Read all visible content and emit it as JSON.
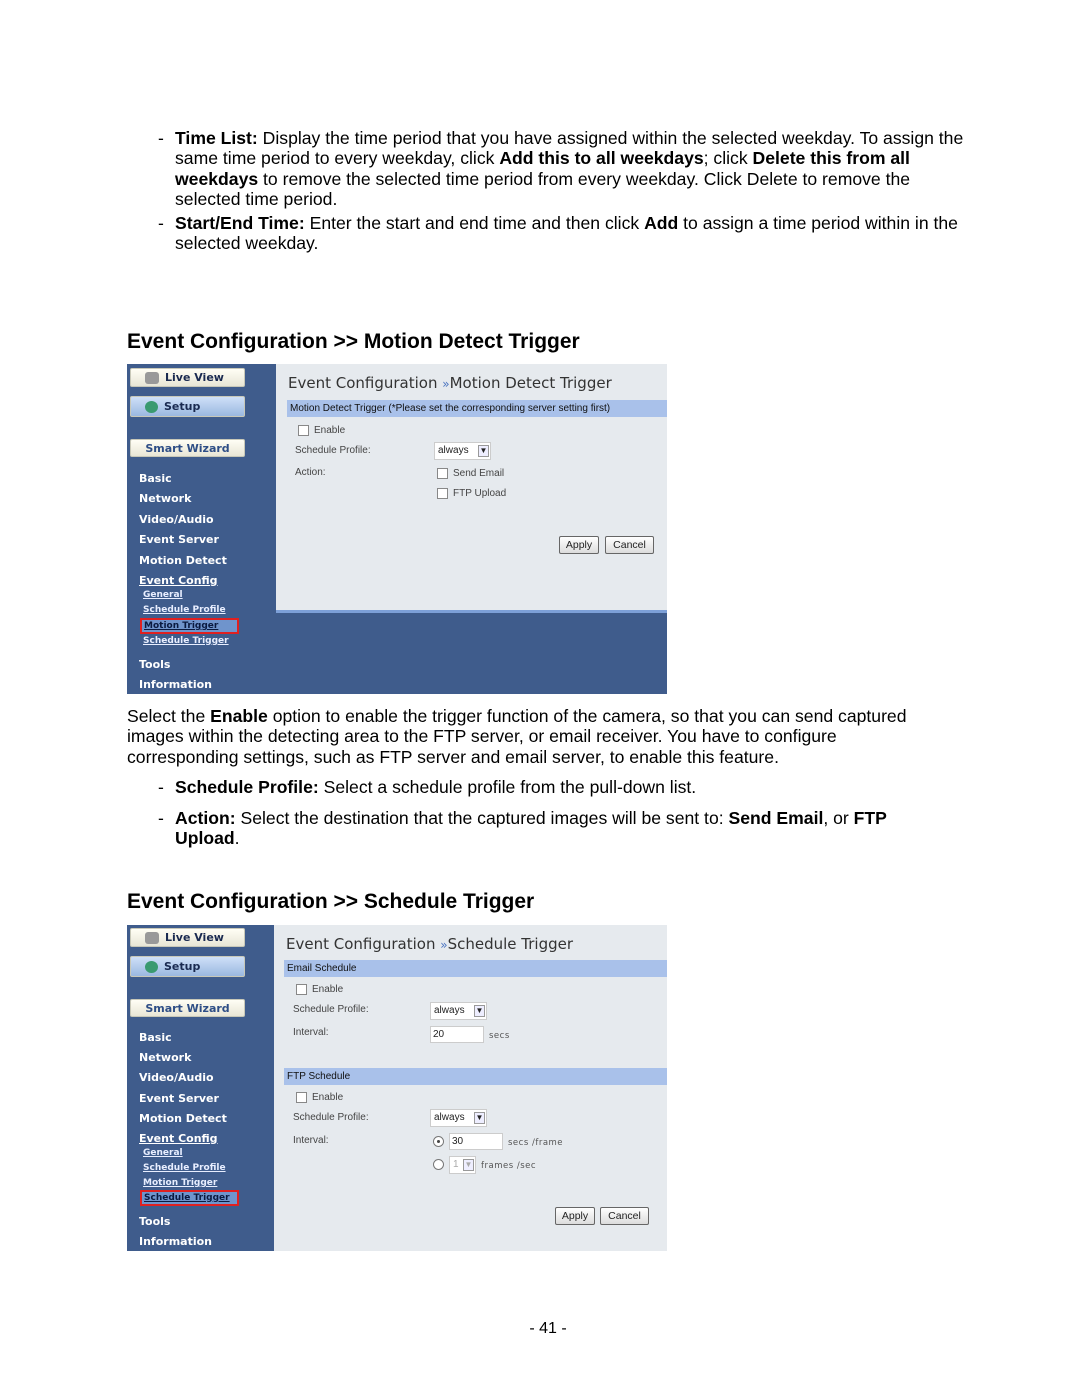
{
  "intro_bullets": [
    {
      "bold1": "Time List:",
      "t1": " Display the time period that you have assigned within the selected weekday. To assign the same time period to every weekday, click ",
      "bold2": "Add this to all weekdays",
      "t2": "; click ",
      "bold3": "Delete this from all weekdays",
      "t3": " to remove the selected time period from every weekday. Click Delete to remove the selected time period."
    },
    {
      "bold1": "Start/End Time:",
      "t1": " Enter the start and end time and then click ",
      "bold2": "Add",
      "t2": " to assign a time period within in the selected weekday."
    }
  ],
  "section1": {
    "heading": "Event Configuration >> Motion Detect Trigger"
  },
  "section2": {
    "heading": "Event Configuration >> Schedule Trigger"
  },
  "sidebar": {
    "live_view": "Live View",
    "setup": "Setup",
    "smart_wizard": "Smart Wizard",
    "basic": "Basic",
    "network": "Network",
    "video_audio": "Video/Audio",
    "event_server": "Event Server",
    "motion_detect": "Motion Detect",
    "event_config": "Event Config",
    "general": "General",
    "schedule_profile": "Schedule Profile",
    "motion_trigger": "Motion Trigger",
    "schedule_trigger": "Schedule Trigger",
    "tools": "Tools",
    "information": "Information"
  },
  "motion_panel": {
    "title_a": "Event Configuration",
    "sep": "»",
    "title_b": "Motion Detect Trigger",
    "bar": "Motion Detect Trigger (*Please set the corresponding server setting first)",
    "enable": "Enable",
    "schedule_profile_label": "Schedule Profile:",
    "schedule_profile_value": "always",
    "action_label": "Action:",
    "send_email": "Send Email",
    "ftp_upload": "FTP Upload",
    "apply": "Apply",
    "cancel": "Cancel",
    "active_nav": "Motion Trigger"
  },
  "schedule_panel": {
    "title_a": "Event Configuration",
    "sep": "»",
    "title_b": "Schedule Trigger",
    "email_bar": "Email Schedule",
    "email_enable": "Enable",
    "email_profile_label": "Schedule Profile:",
    "email_profile_value": "always",
    "email_interval_label": "Interval:",
    "email_interval_value": "20",
    "email_interval_unit": "secs",
    "ftp_bar": "FTP Schedule",
    "ftp_enable": "Enable",
    "ftp_profile_label": "Schedule Profile:",
    "ftp_profile_value": "always",
    "ftp_interval_label": "Interval:",
    "ftp_interval_value": "30",
    "ftp_interval_unit": "secs /frame",
    "ftp_fps_value": "1",
    "ftp_fps_unit": "frames /sec",
    "apply": "Apply",
    "cancel": "Cancel",
    "active_nav": "Schedule Trigger",
    "selected_interval_mode": "secs /frame"
  },
  "body1": {
    "t1": "Select the ",
    "b1": "Enable",
    "t2": " option to enable the trigger function of the camera, so that you can send captured images within the detecting area to the FTP server, or email receiver. You have to configure corresponding settings, such as FTP server and email server, to enable this feature."
  },
  "body_bullets": [
    {
      "bold1": "Schedule Profile:",
      "t1": " Select a schedule profile from the pull-down list."
    },
    {
      "bold1": "Action:",
      "t1": " Select the destination that the captured images will be sent to: ",
      "bold2": "Send Email",
      "t2": ", or ",
      "bold3": "FTP Upload",
      "t3": "."
    }
  ],
  "page_number": "- 41 -",
  "colors": {
    "sidebar": "#3f5c8c",
    "content_bg": "#e6eaee",
    "section_bar": "#a9c1ea",
    "highlight_border": "#e02020"
  }
}
